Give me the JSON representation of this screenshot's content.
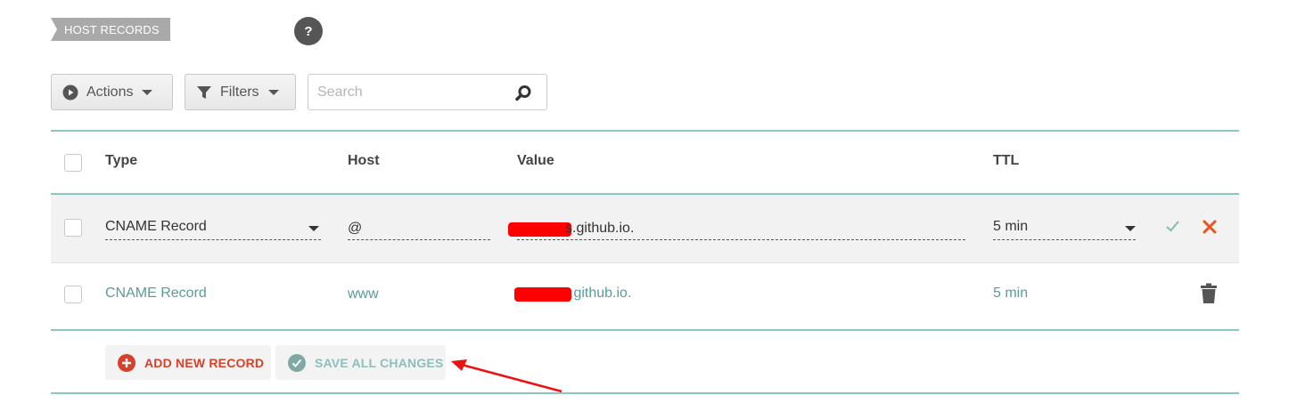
{
  "section": {
    "tag_label": "HOST RECORDS",
    "help_label": "?"
  },
  "toolbar": {
    "actions_label": "Actions",
    "filters_label": "Filters",
    "search_placeholder": "Search"
  },
  "table": {
    "headers": {
      "type": "Type",
      "host": "Host",
      "value": "Value",
      "ttl": "TTL"
    },
    "rows": [
      {
        "type": "CNAME Record",
        "host": "@",
        "value_suffix": "s.github.io.",
        "ttl": "5 min",
        "mode": "edit"
      },
      {
        "type": "CNAME Record",
        "host": "www",
        "value_suffix": ".github.io.",
        "ttl": "5 min",
        "mode": "view"
      }
    ]
  },
  "footer": {
    "add_label": "ADD NEW RECORD",
    "save_label": "SAVE ALL CHANGES"
  },
  "colors": {
    "accent_teal": "#8dc6bf",
    "danger_red": "#d5412a",
    "redaction": "#ff0000",
    "confirm_teal": "#8fbfba"
  },
  "icons": [
    "play-icon",
    "filter-icon",
    "search-icon",
    "check-icon",
    "close-icon",
    "trash-icon",
    "plus-icon",
    "checkmark-circle-icon",
    "help-icon"
  ]
}
